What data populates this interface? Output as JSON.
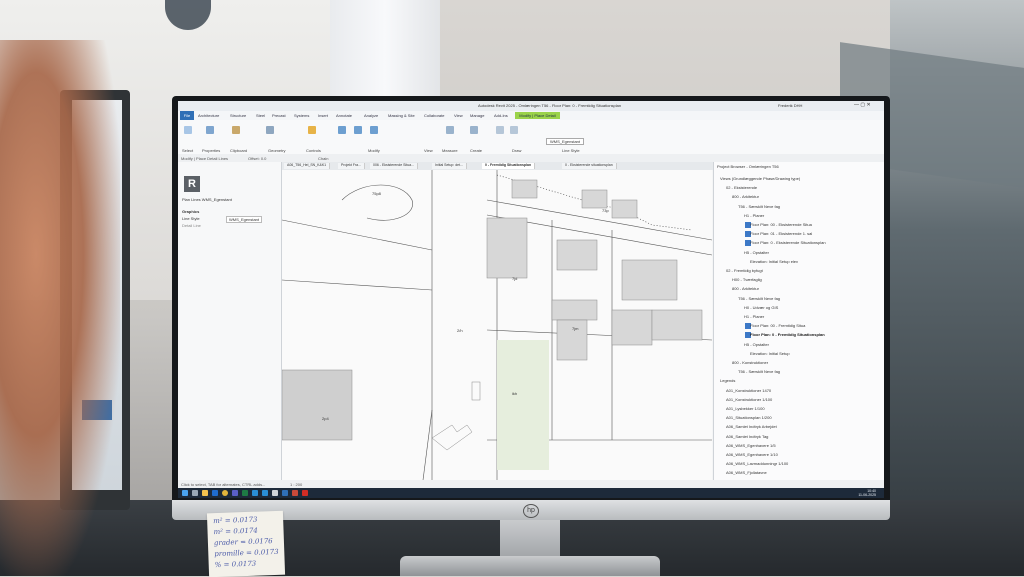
{
  "revit": {
    "window_title": "Autodesk Revit 2025 - Omlæringen T56 - Floor Plan: 0 - Fremtidig Situationsplan",
    "user": "Frederik DHH",
    "file_tab": "File",
    "tabs": [
      "Architecture",
      "Structure",
      "Steel",
      "Precast",
      "Systems",
      "Insert",
      "Annotate",
      "Analyze",
      "Massing & Site",
      "Collaborate",
      "View",
      "Manage",
      "Add-Ins"
    ],
    "context_tab": "Modify | Place Detail Lines",
    "ribbon_groups": [
      "Select",
      "Properties",
      "Clipboard",
      "Geometry",
      "Controls",
      "Modify",
      "View",
      "Measure",
      "Create",
      "Draw",
      "Line Style"
    ],
    "line_style_value": "WMS_Egenstant",
    "option_bar": "Modify | Place Detail Lines",
    "option_bar_offset": "Offset: 0.0",
    "option_bar_chain": "Chain",
    "properties": {
      "type_selector": "Plan Lines WMS_Egenstant",
      "section": "Graphics",
      "line_style_label": "Line Style",
      "line_style_value": "WMS_Egenstant",
      "detail_line": "Detail Line"
    },
    "doc_tabs": [
      "A06_T56_Hel_SN_K&K1",
      "Projekt Fra...",
      "006 - Eksisterende Situa...",
      "Initial Setup: det...",
      "0 - Fremtidig Situationsplan",
      "0 - Eksisterende situationsplan"
    ],
    "project_browser": {
      "title": "Project Browser - Omlæringen T56",
      "items": [
        "Views (Grundlæggende Phase/Drawing type)",
        "02 - Eksisterende",
        "800 - Arkitektur",
        "T56 - Særskilt Neve fag",
        "H1 - Planer",
        "Floor Plan: 00 - Eksisterende Situa",
        "Floor Plan: 01 - Eksisterende 1. sal",
        "Floor Plan: 0 - Eksisterende Situationsplan",
        "H5 - Opstalter",
        "Elevation: Initial Setup elev",
        "02 - Fremtidig byfugt",
        "H00 - Tværfaglig",
        "800 - Arkitektur",
        "T56 - Særskilt Neve fag",
        "H0 - Udvær og GIS",
        "H1 - Planer",
        "Floor Plan: 00 - Fremtidig Situa",
        "Floor Plan: 0 - Fremtidig Situationsplan",
        "H5 - Opstalter",
        "Elevation: Initial Setup",
        "800 - Konstruktioner",
        "T56 - Særskilt Neve fag",
        "Legends",
        "A01_Konstruktioner 1470",
        "A01_Konstruktioner 1/100",
        "A01_Lysbekker 1/100",
        "A01_Situationsplan 1/200",
        "A06_Samlet Indtryk Arbejdet",
        "A06_Samlet Indtryk Tag",
        "A06_WMS_Egenhavere 1/5",
        "A06_WMS_Egenhavere 1/10",
        "A06_WMS_Lavmaddunningr 1/100",
        "A06_WMS_Fjollatavne"
      ]
    },
    "status_text": "Click to select, TAB for alternates, CTRL adds...",
    "status_scale": "1 : 200",
    "clock_time": "10:40",
    "clock_date": "11-06-2025",
    "canvas_labels": [
      "75p8",
      "7jd",
      "2/h",
      "2p4",
      "ikh",
      "73p",
      "7jm"
    ]
  },
  "sticky_note": [
    "m² = 0.0173",
    "m² = 0.0174",
    "grader = 0.0176",
    "promille = 0.0173",
    "% = 0.0173"
  ],
  "colors": {
    "revit_blue": "#2f6fb6",
    "context_green": "#9bd34a",
    "taskbar": "#1d2a3a"
  }
}
